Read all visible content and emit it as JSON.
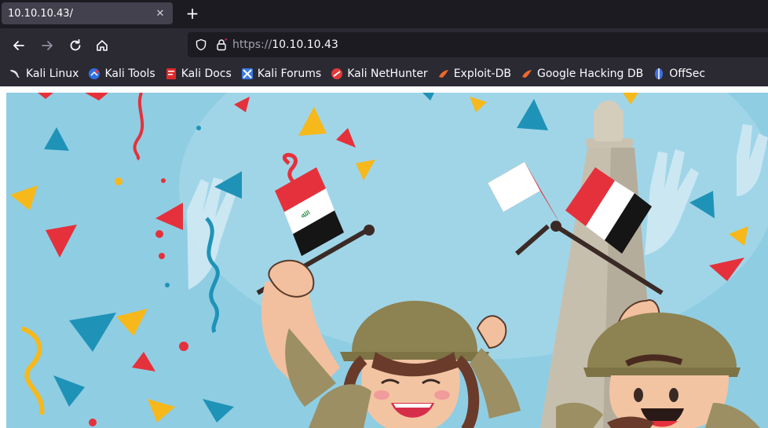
{
  "tab": {
    "title": "10.10.10.43/"
  },
  "urlbar": {
    "scheme": "https://",
    "host": "10.10.10.43"
  },
  "bookmarks": [
    {
      "label": "Kali Linux",
      "icon": "kali-dragon-icon",
      "color": "#ffffff"
    },
    {
      "label": "Kali Tools",
      "icon": "kali-tools-icon",
      "color": "#2f6fe4"
    },
    {
      "label": "Kali Docs",
      "icon": "kali-docs-icon",
      "color": "#e02a2a"
    },
    {
      "label": "Kali Forums",
      "icon": "kali-forums-icon",
      "color": "#3b7be0"
    },
    {
      "label": "Kali NetHunter",
      "icon": "nethunter-icon",
      "color": "#e23a3a"
    },
    {
      "label": "Exploit-DB",
      "icon": "exploit-db-icon",
      "color": "#f0682a"
    },
    {
      "label": "Google Hacking DB",
      "icon": "ghdb-icon",
      "color": "#f0682a"
    },
    {
      "label": "OffSec",
      "icon": "offsec-icon",
      "color": "#3d6fe0"
    }
  ],
  "colors": {
    "sky": "#8fcde3",
    "flag_red": "#e5313b",
    "flag_green": "#1c8a3c",
    "helmet": "#8d8252",
    "accent_blue": "#1f93b7",
    "accent_yellow": "#f6b81b"
  }
}
